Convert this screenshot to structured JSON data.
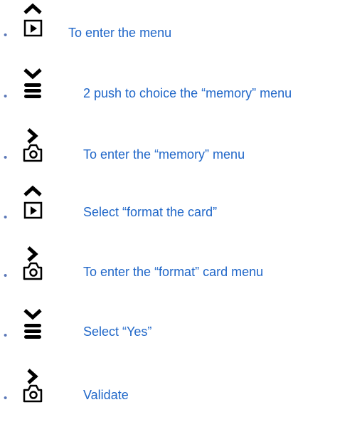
{
  "steps": [
    {
      "icon": "play-up-icon",
      "text": "To enter the menu"
    },
    {
      "icon": "menu-down-icon",
      "text": "2 push to choice the “memory” menu"
    },
    {
      "icon": "camera-right-icon",
      "text": "To enter the “memory” menu"
    },
    {
      "icon": "play-up-icon",
      "text": "Select “format the card”"
    },
    {
      "icon": "camera-right-icon",
      "text": "To enter the “format” card menu"
    },
    {
      "icon": "menu-down-icon",
      "text": "Select “Yes”"
    },
    {
      "icon": "camera-right-icon",
      "text": "Validate"
    }
  ],
  "bullet": "•"
}
